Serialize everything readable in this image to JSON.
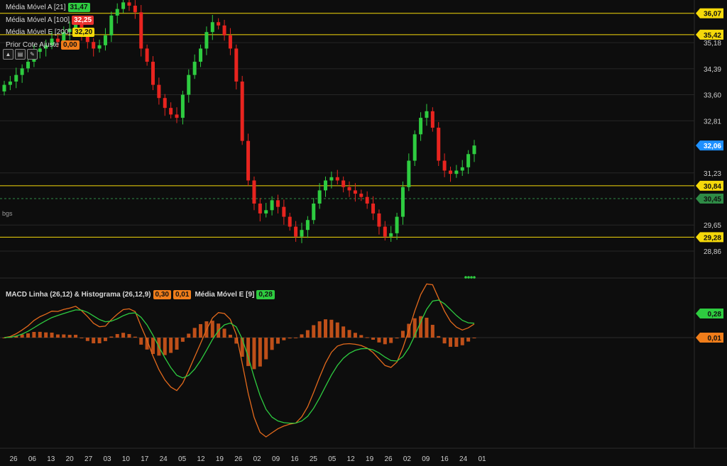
{
  "indicators": [
    {
      "label": "Média Móvel A [21]",
      "value": "31,47",
      "color": "#2ecc40"
    },
    {
      "label": "Média Móvel A [100]",
      "value": "32,25",
      "color": "#e8322f"
    },
    {
      "label": "Média Móvel E [200]",
      "value": "32,20",
      "color": "#f5d90a"
    },
    {
      "label": "Prior Cote Ajuste",
      "value": "0,00",
      "color": "#f07d1a"
    }
  ],
  "toolbar_icons": [
    "triangle-up-icon",
    "chart-icon",
    "pencil-icon"
  ],
  "macd_legend": {
    "label": "MACD Linha (26,12) & Histograma (26,12,9)",
    "macd_value": "0,30",
    "hist_value": "0,01",
    "signal_label": "Média Móvel E [9]",
    "signal_value": "0,28"
  },
  "annotation_text": "bgs",
  "chart_data": {
    "type": "candlestick",
    "price_axis": {
      "ticks": [
        "35,18",
        "34,39",
        "33,60",
        "32,81",
        "31,23",
        "29,65",
        "28,86"
      ],
      "range": [
        28.5,
        36.3
      ]
    },
    "price_levels": [
      {
        "value": 36.07,
        "label": "36,07",
        "color": "#f5d90a",
        "style": "solid"
      },
      {
        "value": 35.42,
        "label": "35,42",
        "color": "#f5d90a",
        "style": "solid"
      },
      {
        "value": 32.06,
        "label": "32,06",
        "color": "#1e90ff",
        "style": "marker"
      },
      {
        "value": 30.84,
        "label": "30,84",
        "color": "#f5d90a",
        "style": "solid"
      },
      {
        "value": 30.45,
        "label": "30,45",
        "color": "#2e8b46",
        "style": "dashed"
      },
      {
        "value": 29.28,
        "label": "29,28",
        "color": "#f5d90a",
        "style": "solid"
      }
    ],
    "x_labels": [
      "26",
      "06",
      "13",
      "20",
      "27",
      "03",
      "10",
      "17",
      "24",
      "05",
      "12",
      "19",
      "26",
      "02",
      "09",
      "16",
      "25",
      "05",
      "12",
      "19",
      "26",
      "02",
      "09",
      "16",
      "24",
      "01"
    ],
    "macd_markers": [
      {
        "value": 0.28,
        "label": "0,28",
        "color": "#2ecc40"
      },
      {
        "value": 0.01,
        "label": "0,01",
        "color": "#f07d1a"
      }
    ],
    "candles_close": [
      33.9,
      34.0,
      34.2,
      34.4,
      34.6,
      34.9,
      35.0,
      35.1,
      35.3,
      35.2,
      35.5,
      35.6,
      35.8,
      35.4,
      35.2,
      35.0,
      35.1,
      35.4,
      36.0,
      36.2,
      36.4,
      36.3,
      36.1,
      35.0,
      34.6,
      33.9,
      33.5,
      33.2,
      33.0,
      32.9,
      33.6,
      34.2,
      34.6,
      35.0,
      35.5,
      35.8,
      35.7,
      35.4,
      35.0,
      34.0,
      32.2,
      31.0,
      30.3,
      30.0,
      30.1,
      30.4,
      30.2,
      29.9,
      29.6,
      29.3,
      29.5,
      29.8,
      30.3,
      30.7,
      31.0,
      31.1,
      31.0,
      30.8,
      30.7,
      30.6,
      30.5,
      30.3,
      30.0,
      29.6,
      29.3,
      29.4,
      29.9,
      30.8,
      31.6,
      32.4,
      32.9,
      33.1,
      32.6,
      31.6,
      31.3,
      31.2,
      31.3,
      31.4,
      31.8,
      32.06
    ]
  }
}
